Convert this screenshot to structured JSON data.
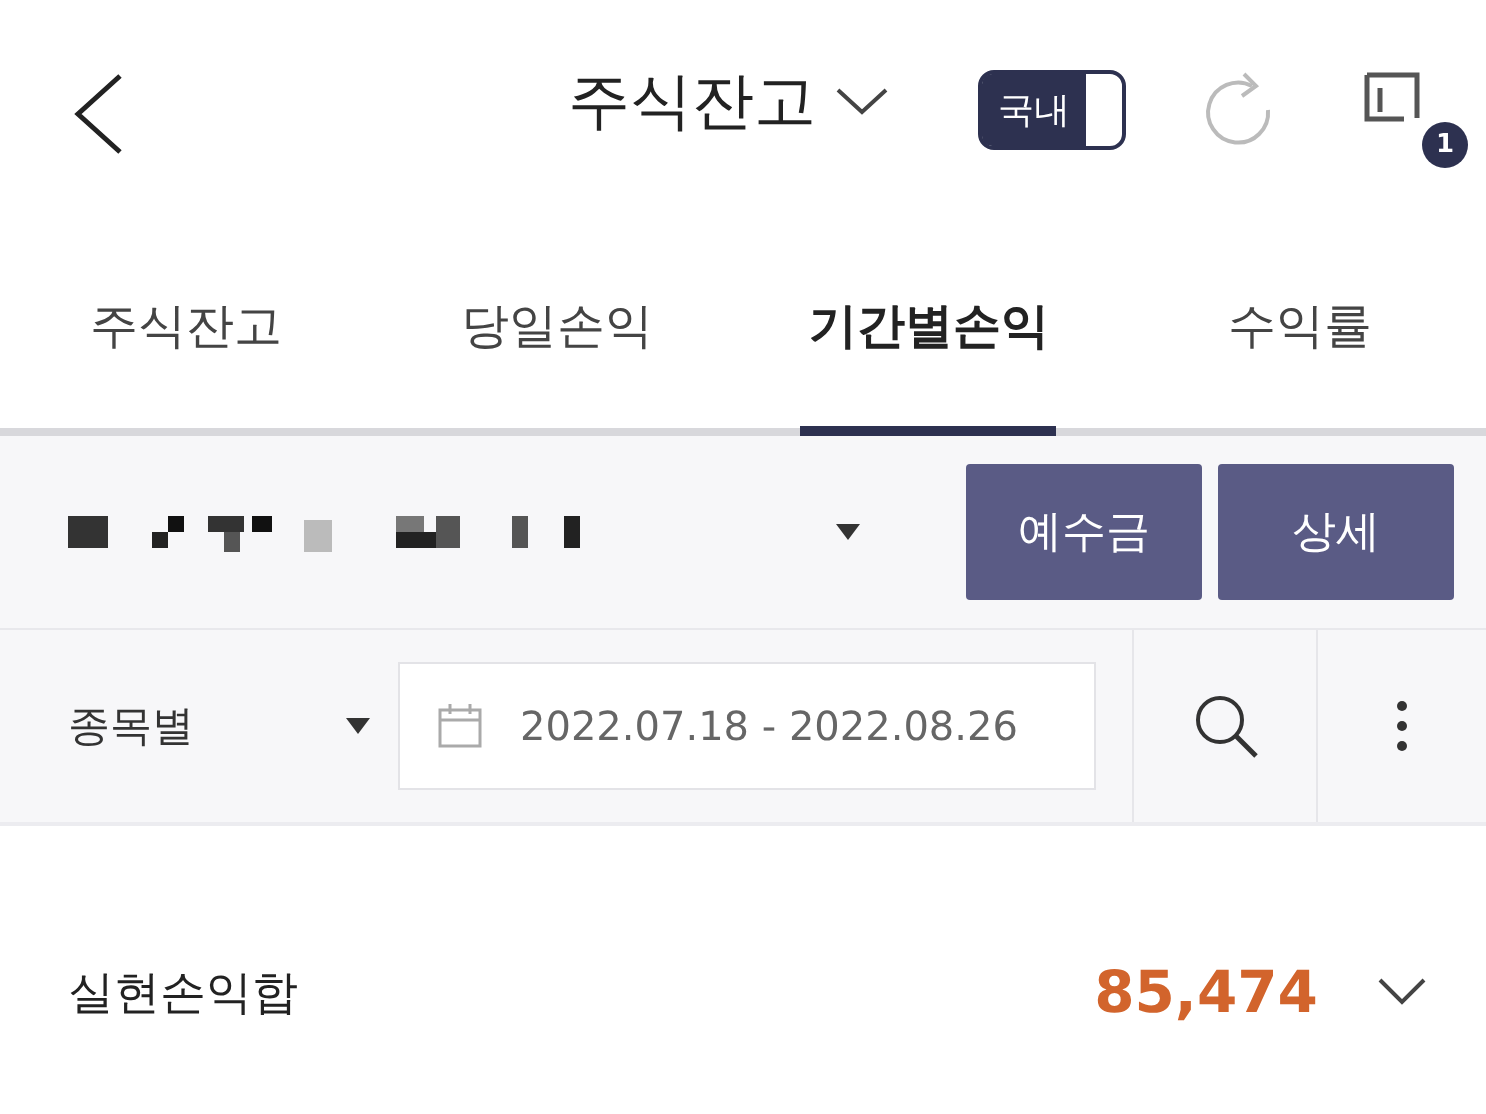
{
  "header": {
    "title": "주식잔고",
    "market_toggle": "국내",
    "badge": "1"
  },
  "tabs": [
    {
      "label": "주식잔고",
      "selected": false
    },
    {
      "label": "당일손익",
      "selected": false
    },
    {
      "label": "기간별손익",
      "selected": true
    },
    {
      "label": "수익률",
      "selected": false
    }
  ],
  "account": {
    "buttons": [
      "예수금",
      "상세"
    ]
  },
  "filter": {
    "group": "종목별",
    "date_range": "2022.07.18 - 2022.08.26"
  },
  "summary": {
    "label": "실현손익합",
    "value": "85,474"
  }
}
